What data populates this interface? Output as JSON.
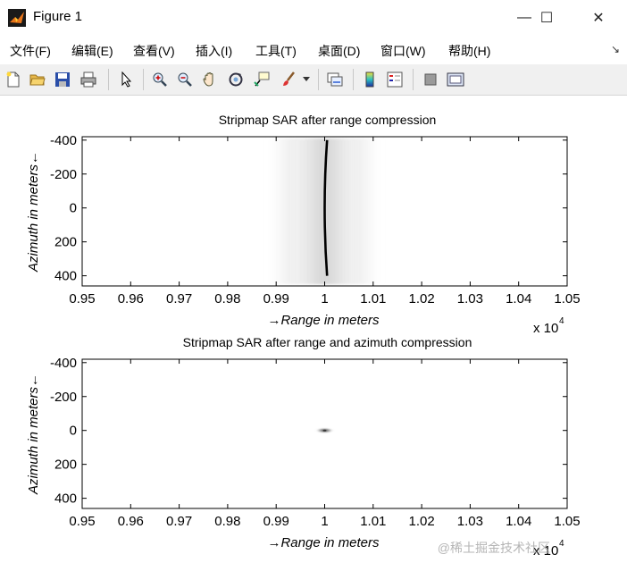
{
  "window": {
    "title": "Figure 1",
    "minimize": "—",
    "maximize": "☐",
    "close": "✕"
  },
  "menu": [
    {
      "label": "文件(F)"
    },
    {
      "label": "编辑(E)"
    },
    {
      "label": "查看(V)"
    },
    {
      "label": "插入(I)"
    },
    {
      "label": "工具(T)"
    },
    {
      "label": "桌面(D)"
    },
    {
      "label": "窗口(W)"
    },
    {
      "label": "帮助(H)"
    }
  ],
  "toolbar": [
    {
      "icon": "new-figure-icon"
    },
    {
      "icon": "open-icon"
    },
    {
      "icon": "save-icon"
    },
    {
      "icon": "print-icon"
    },
    {
      "icon": "select-arrow-icon"
    },
    {
      "icon": "zoom-in-icon"
    },
    {
      "icon": "zoom-out-icon"
    },
    {
      "icon": "pan-hand-icon"
    },
    {
      "icon": "rotate-3d-icon"
    },
    {
      "icon": "data-cursor-icon"
    },
    {
      "icon": "brush-icon"
    },
    {
      "icon": "link-plot-icon"
    },
    {
      "icon": "colorbar-icon"
    },
    {
      "icon": "legend-icon"
    },
    {
      "icon": "hide-plot-tools-icon"
    },
    {
      "icon": "show-plot-tools-icon"
    }
  ],
  "watermark": "@稀土掘金技术社区",
  "chart_data": [
    {
      "type": "heatmap",
      "title": "Stripmap SAR after range compression",
      "xlabel": "→Range in meters",
      "ylabel": "Azimuth in meters←",
      "x_exponent": "x 10",
      "x_exponent_power": "4",
      "xlim": [
        0.95,
        1.05
      ],
      "ylim": [
        -420,
        460
      ],
      "y_reversed": true,
      "x_ticks": [
        "0.95",
        "0.96",
        "0.97",
        "0.98",
        "0.99",
        "1",
        "1.01",
        "1.02",
        "1.03",
        "1.04",
        "1.05"
      ],
      "x_tick_values": [
        0.95,
        0.96,
        0.97,
        0.98,
        0.99,
        1.0,
        1.01,
        1.02,
        1.03,
        1.04,
        1.05
      ],
      "y_ticks": [
        "-400",
        "-200",
        "0",
        "200",
        "400"
      ],
      "y_tick_values": [
        -400,
        -200,
        0,
        200,
        400
      ],
      "colormap": "gray-inverted",
      "feature": {
        "kind": "range-migration-curve",
        "x_center": 1.0,
        "x_offset_at_edges": 0.0005,
        "y_range": [
          -400,
          400
        ]
      }
    },
    {
      "type": "heatmap",
      "title": "Stripmap SAR after range and azimuth compression",
      "xlabel": "→Range in meters",
      "ylabel": "Azimuth in meters←",
      "x_exponent": "x 10",
      "x_exponent_power": "4",
      "xlim": [
        0.95,
        1.05
      ],
      "ylim": [
        -420,
        460
      ],
      "y_reversed": true,
      "x_ticks": [
        "0.95",
        "0.96",
        "0.97",
        "0.98",
        "0.99",
        "1",
        "1.01",
        "1.02",
        "1.03",
        "1.04",
        "1.05"
      ],
      "x_tick_values": [
        0.95,
        0.96,
        0.97,
        0.98,
        0.99,
        1.0,
        1.01,
        1.02,
        1.03,
        1.04,
        1.05
      ],
      "y_ticks": [
        "-400",
        "-200",
        "0",
        "200",
        "400"
      ],
      "y_tick_values": [
        -400,
        -200,
        0,
        200,
        400
      ],
      "colormap": "gray-inverted",
      "feature": {
        "kind": "point-target",
        "x": 1.0,
        "y": 0
      }
    }
  ]
}
